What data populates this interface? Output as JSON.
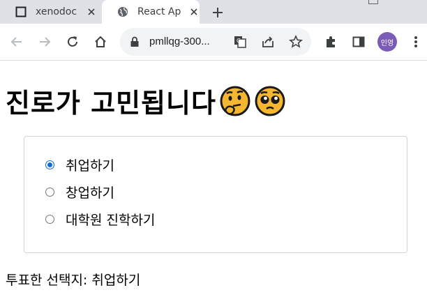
{
  "tabs": [
    {
      "title": "xenodoc",
      "favicon": "square-page-icon",
      "active": false
    },
    {
      "title": "React Ap",
      "favicon": "globe-icon",
      "active": true
    }
  ],
  "toolbar": {
    "url": "pmllqg-300...",
    "profile_label": "인영",
    "icons": [
      "back-arrow-icon",
      "forward-arrow-icon",
      "reload-icon",
      "home-icon",
      "lock-icon",
      "translate-icon",
      "share-icon",
      "star-icon",
      "extensions-icon",
      "side-panel-icon",
      "menu-icon"
    ]
  },
  "page": {
    "heading": "진로가 고민됩니다",
    "heading_emojis": [
      "thinking-face",
      "pleading-face"
    ],
    "options": [
      {
        "label": "취업하기",
        "checked": true
      },
      {
        "label": "창업하기",
        "checked": false
      },
      {
        "label": "대학원 진학하기",
        "checked": false
      }
    ],
    "result_label": "투표한 선택지:",
    "result_value": "취업하기"
  },
  "colors": {
    "accent": "#0f6bd8",
    "tabstrip": "#dee1e6",
    "avatar": "#7b5bb6"
  }
}
